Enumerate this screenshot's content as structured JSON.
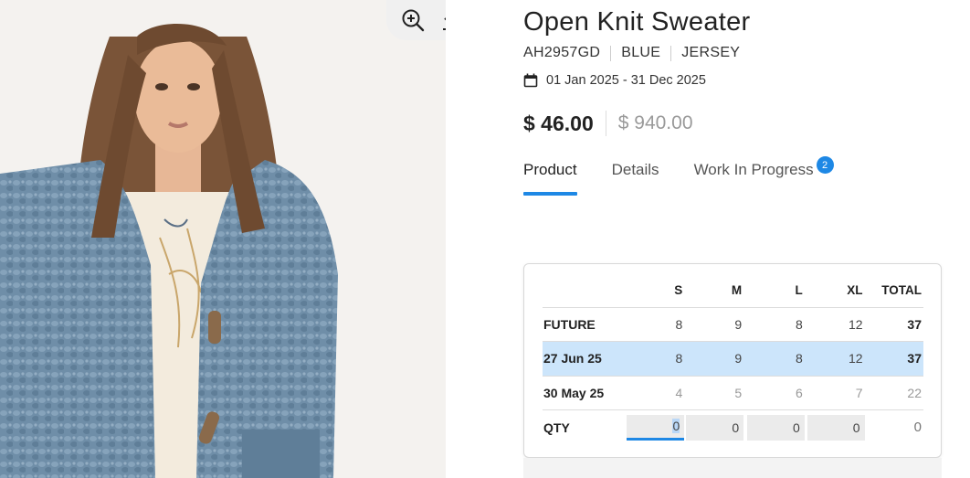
{
  "image_tools": {
    "zoom_icon": "zoom-in-icon",
    "download_icon": "download-icon"
  },
  "product": {
    "title": "Open Knit Sweater",
    "code": "AH2957GD",
    "color": "BLUE",
    "fabric": "JERSEY",
    "date_range": "01 Jan 2025 - 31 Dec 2025",
    "price": "$ 46.00",
    "alt_price": "$ 940.00"
  },
  "tabs": [
    {
      "label": "Product",
      "active": true
    },
    {
      "label": "Details",
      "active": false
    },
    {
      "label": "Work In Progress",
      "active": false,
      "badge": "2"
    }
  ],
  "table": {
    "headers": [
      "",
      "S",
      "M",
      "L",
      "XL",
      "TOTAL"
    ],
    "rows": [
      {
        "label": "FUTURE",
        "values": [
          "8",
          "9",
          "8",
          "12"
        ],
        "total": "37"
      },
      {
        "label": "27 Jun 25",
        "values": [
          "8",
          "9",
          "8",
          "12"
        ],
        "total": "37"
      },
      {
        "label": "30 May 25",
        "values": [
          "4",
          "5",
          "6",
          "7"
        ],
        "total": "22"
      }
    ],
    "qty": {
      "label": "QTY",
      "values": [
        "0",
        "0",
        "0",
        "0"
      ],
      "total": "0"
    }
  },
  "colors": {
    "accent": "#1e88e5",
    "row_highlight": "#cce5fb",
    "sweater": "#6f8ea8"
  }
}
